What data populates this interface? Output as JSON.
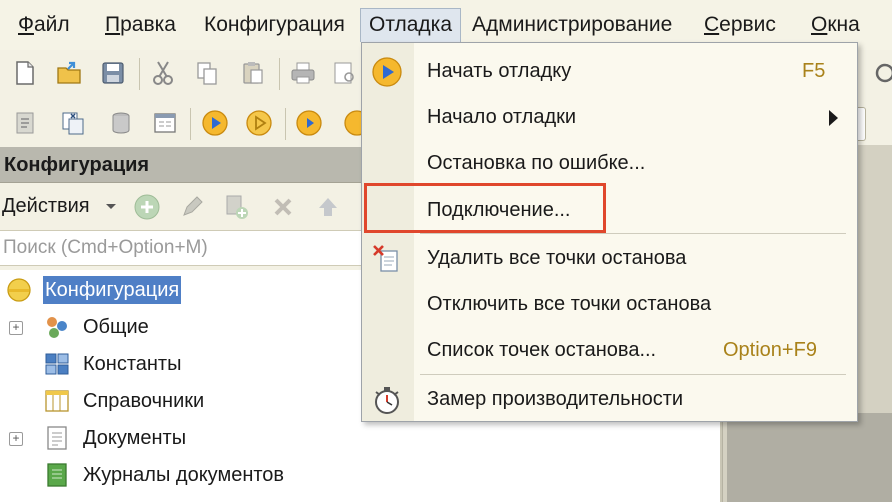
{
  "menubar": {
    "items": [
      {
        "mnemonic": "Ф",
        "rest": "айл"
      },
      {
        "mnemonic": "П",
        "rest": "равка"
      },
      {
        "mnemonic": "",
        "rest": "Конфигурация"
      },
      {
        "mnemonic": "",
        "rest": "Отладка"
      },
      {
        "mnemonic": "",
        "rest": "Администрирование"
      },
      {
        "mnemonic": "С",
        "rest": "ервис"
      },
      {
        "mnemonic": "О",
        "rest": "кна"
      }
    ],
    "active_index": 3
  },
  "panel": {
    "title": "Конфигурация",
    "actions_label": "Действия",
    "search_placeholder": "Поиск (Cmd+Option+M)"
  },
  "tree": {
    "items": [
      {
        "label": "Конфигурация",
        "icon": "configuration-icon",
        "expandable": false,
        "selected": true
      },
      {
        "label": "Общие",
        "icon": "common-objects-icon",
        "expandable": true,
        "selected": false
      },
      {
        "label": "Константы",
        "icon": "constants-icon",
        "expandable": false,
        "selected": false
      },
      {
        "label": "Справочники",
        "icon": "catalogs-icon",
        "expandable": false,
        "selected": false
      },
      {
        "label": "Документы",
        "icon": "documents-icon",
        "expandable": true,
        "selected": false
      },
      {
        "label": "Журналы документов",
        "icon": "document-journals-icon",
        "expandable": false,
        "selected": false
      }
    ]
  },
  "debug_menu": {
    "items": [
      {
        "label": "Начать отладку",
        "shortcut": "F5",
        "icon": "play-icon",
        "submenu": false
      },
      {
        "label": "Начало отладки",
        "shortcut": "",
        "icon": "",
        "submenu": true
      },
      {
        "label": "Остановка по ошибке...",
        "shortcut": "",
        "icon": "",
        "submenu": false
      },
      {
        "label": "Подключение...",
        "shortcut": "",
        "icon": "",
        "submenu": false,
        "highlighted": true
      },
      {
        "label": "Удалить все точки останова",
        "shortcut": "",
        "icon": "delete-breakpoints-icon",
        "submenu": false
      },
      {
        "label": "Отключить все точки останова",
        "shortcut": "",
        "icon": "",
        "submenu": false
      },
      {
        "label": "Список точек останова...",
        "shortcut": "Option+F9",
        "icon": "",
        "submenu": false
      },
      {
        "label": "Замер производительности",
        "shortcut": "",
        "icon": "stopwatch-icon",
        "submenu": false
      }
    ]
  },
  "colors": {
    "highlight_outline": "#e0472c",
    "selection": "#4f7fc6",
    "shortcut_text": "#a9821a"
  }
}
